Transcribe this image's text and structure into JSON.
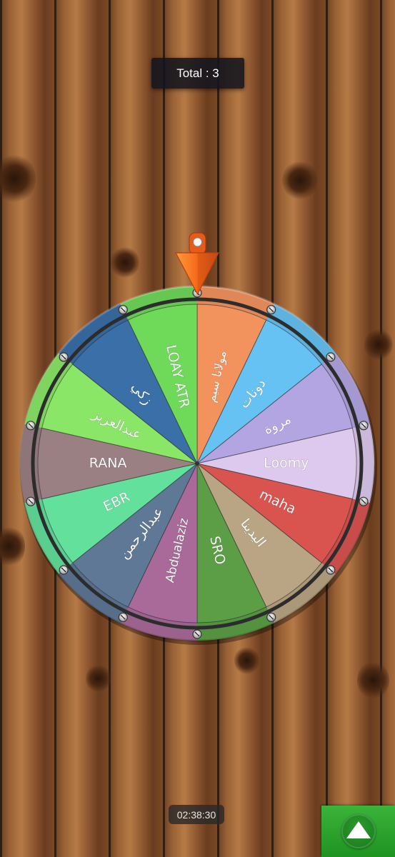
{
  "total": {
    "label": "Total : 3"
  },
  "timer": {
    "text": "02:38:30"
  },
  "spin_button": {
    "icon": "triangle-up-icon"
  },
  "wheel": {
    "segments": [
      {
        "label": "مولانا سيم",
        "color": "#f2935e"
      },
      {
        "label": "دونات",
        "color": "#66c2f2"
      },
      {
        "label": "مروة",
        "color": "#b3a4e2"
      },
      {
        "label": "Loomy",
        "color": "#ddc9ee"
      },
      {
        "label": "maha",
        "color": "#d9534f"
      },
      {
        "label": "اليدينا",
        "color": "#b9a583"
      },
      {
        "label": "SRO",
        "color": "#5b9e46"
      },
      {
        "label": "Abdualaziz",
        "color": "#a96a9a"
      },
      {
        "label": "عبدالرحمن",
        "color": "#5f7896"
      },
      {
        "label": "EBR",
        "color": "#63e09b"
      },
      {
        "label": "RANA",
        "color": "#9a7f83"
      },
      {
        "label": "عبدالعزيز",
        "color": "#8ae667"
      },
      {
        "label": "زكي",
        "color": "#3a6fa7"
      },
      {
        "label": "LOAY ATR",
        "color": "#6fd95a"
      }
    ]
  }
}
